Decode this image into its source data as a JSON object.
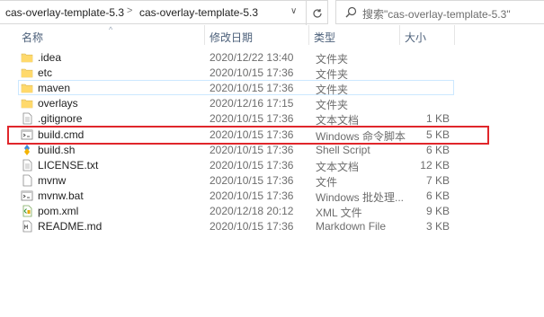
{
  "address": {
    "crumbs": [
      "cas-overlay-template-5.3",
      "cas-overlay-template-5.3"
    ],
    "separator": ">",
    "dropdown_icon": "chevron-down-icon",
    "refresh_icon": "refresh-icon"
  },
  "search": {
    "placeholder": "搜索\"cas-overlay-template-5.3\""
  },
  "columns": {
    "name": "名称",
    "date": "修改日期",
    "type": "类型",
    "size": "大小",
    "sort": "^"
  },
  "files": [
    {
      "name": ".idea",
      "date": "2020/12/22 13:40",
      "type": "文件夹",
      "size": "",
      "icon": "folder"
    },
    {
      "name": "etc",
      "date": "2020/10/15 17:36",
      "type": "文件夹",
      "size": "",
      "icon": "folder"
    },
    {
      "name": "maven",
      "date": "2020/10/15 17:36",
      "type": "文件夹",
      "size": "",
      "icon": "folder"
    },
    {
      "name": "overlays",
      "date": "2020/12/16 17:15",
      "type": "文件夹",
      "size": "",
      "icon": "folder"
    },
    {
      "name": ".gitignore",
      "date": "2020/10/15 17:36",
      "type": "文本文档",
      "size": "1 KB",
      "icon": "text"
    },
    {
      "name": "build.cmd",
      "date": "2020/10/15 17:36",
      "type": "Windows 命令脚本",
      "size": "5 KB",
      "icon": "cmd"
    },
    {
      "name": "build.sh",
      "date": "2020/10/15 17:36",
      "type": "Shell Script",
      "size": "6 KB",
      "icon": "sh"
    },
    {
      "name": "LICENSE.txt",
      "date": "2020/10/15 17:36",
      "type": "文本文档",
      "size": "12 KB",
      "icon": "text"
    },
    {
      "name": "mvnw",
      "date": "2020/10/15 17:36",
      "type": "文件",
      "size": "7 KB",
      "icon": "blank"
    },
    {
      "name": "mvnw.bat",
      "date": "2020/10/15 17:36",
      "type": "Windows 批处理...",
      "size": "6 KB",
      "icon": "cmd"
    },
    {
      "name": "pom.xml",
      "date": "2020/12/18 20:12",
      "type": "XML 文件",
      "size": "9 KB",
      "icon": "xml"
    },
    {
      "name": "README.md",
      "date": "2020/10/15 17:36",
      "type": "Markdown File",
      "size": "3 KB",
      "icon": "md"
    }
  ],
  "hover_row": "maven",
  "highlighted_row": "build.cmd",
  "colors": {
    "highlight": "#e0262b",
    "hover": "#cce8ff",
    "folder": "#f8d775",
    "header_text": "#4c607a"
  }
}
